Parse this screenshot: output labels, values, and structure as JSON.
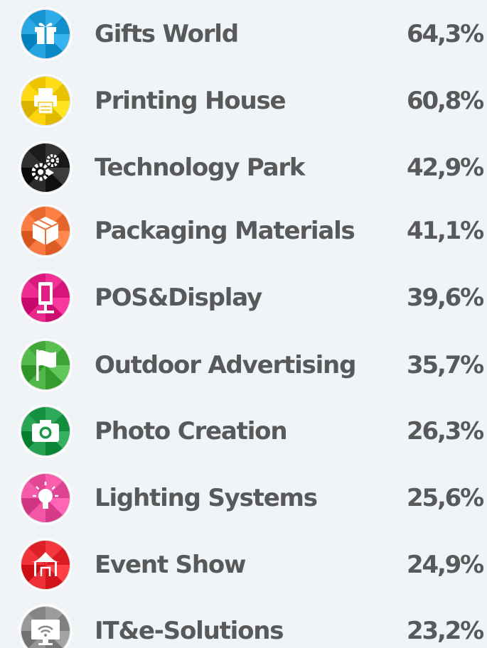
{
  "chart_data": {
    "type": "table",
    "categories": [
      "Gifts World",
      "Printing House",
      "Technology Park",
      "Packaging Materials",
      "POS&Display",
      "Outdoor Advertising",
      "Photo Creation",
      "Lighting Systems",
      "Event Show",
      "IT&e-Solutions"
    ],
    "values": [
      64.3,
      60.8,
      42.9,
      41.1,
      39.6,
      35.7,
      26.3,
      25.6,
      24.9,
      23.2
    ],
    "value_labels": [
      "64,3%",
      "60,8%",
      "42,9%",
      "41,1%",
      "39,6%",
      "35,7%",
      "26,3%",
      "25,6%",
      "24,9%",
      "23,2%"
    ],
    "unit": "%"
  },
  "rows": [
    {
      "label": "Gifts World",
      "value": "64,3%",
      "icon": "gift-icon",
      "color": "#1c9ad6"
    },
    {
      "label": "Printing House",
      "value": "60,8%",
      "icon": "printer-icon",
      "color": "#f2cb05"
    },
    {
      "label": "Technology Park",
      "value": "42,9%",
      "icon": "gears-icon",
      "color": "#222222"
    },
    {
      "label": "Packaging Materials",
      "value": "41,1%",
      "icon": "box-icon",
      "color": "#ee6e35"
    },
    {
      "label": "POS&Display",
      "value": "39,6%",
      "icon": "display-stand-icon",
      "color": "#e01f84"
    },
    {
      "label": "Outdoor Advertising",
      "value": "35,7%",
      "icon": "flag-icon",
      "color": "#47ad3e"
    },
    {
      "label": "Photo Creation",
      "value": "26,3%",
      "icon": "camera-icon",
      "color": "#1c9747"
    },
    {
      "label": "Lighting Systems",
      "value": "25,6%",
      "icon": "lightbulb-icon",
      "color": "#e84d9c"
    },
    {
      "label": "Event Show",
      "value": "24,9%",
      "icon": "tent-icon",
      "color": "#e3262d"
    },
    {
      "label": "IT&e-Solutions",
      "value": "23,2%",
      "icon": "monitor-wifi-icon",
      "color": "#8a8a8a"
    }
  ]
}
